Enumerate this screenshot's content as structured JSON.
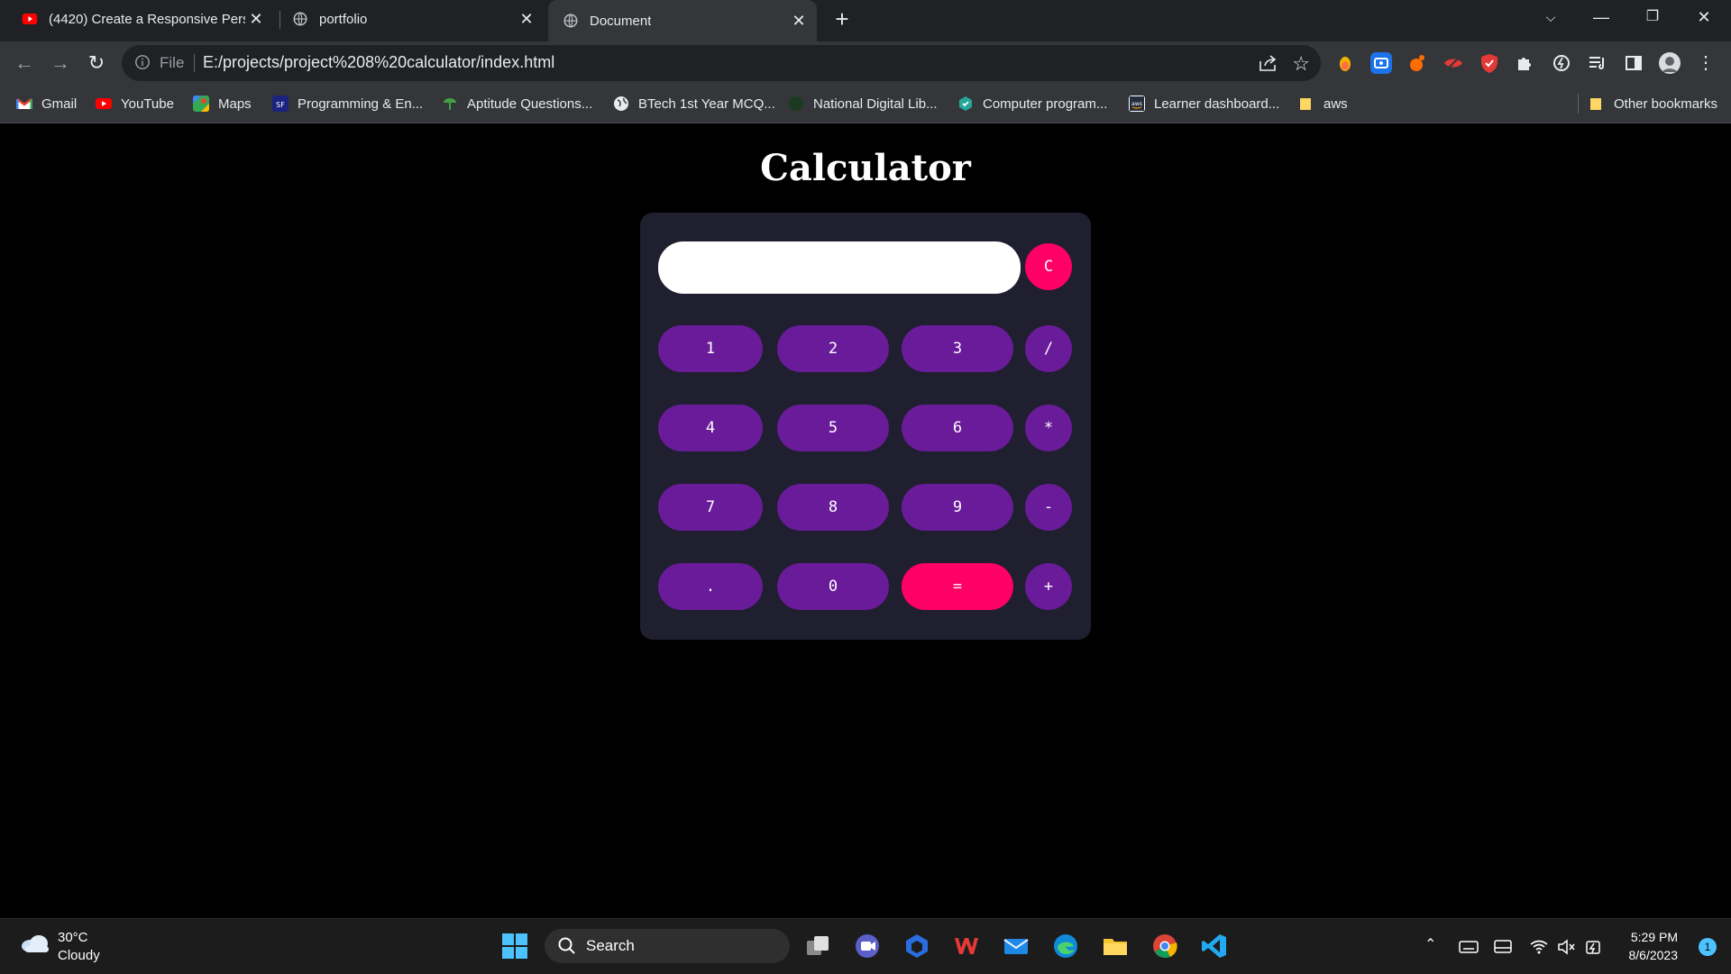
{
  "browser": {
    "tabs": [
      {
        "title": "(4420) Create a Responsive Perso",
        "favicon": "youtube-icon",
        "active": false
      },
      {
        "title": "portfolio",
        "favicon": "globe-icon",
        "active": false
      },
      {
        "title": "Document",
        "favicon": "globe-icon",
        "active": true
      }
    ],
    "new_tab_label": "+",
    "address": {
      "scheme_label": "File",
      "url": "E:/projects/project%208%20calculator/index.html"
    },
    "bookmarks": [
      {
        "label": "Gmail",
        "icon": "gmail-icon"
      },
      {
        "label": "YouTube",
        "icon": "youtube-icon"
      },
      {
        "label": "Maps",
        "icon": "maps-icon"
      },
      {
        "label": "Programming & En...",
        "icon": "programming-icon"
      },
      {
        "label": "Aptitude Questions...",
        "icon": "aptitude-icon"
      },
      {
        "label": "BTech 1st Year MCQ...",
        "icon": "globe-icon"
      },
      {
        "label": "National Digital Lib...",
        "icon": "ndl-icon"
      },
      {
        "label": "Computer program...",
        "icon": "coding-icon"
      },
      {
        "label": "Learner dashboard...",
        "icon": "aws-icon"
      },
      {
        "label": "aws",
        "icon": "folder-icon"
      }
    ],
    "other_bookmarks": "Other bookmarks"
  },
  "page": {
    "title": "Calculator",
    "display_value": "",
    "clear_label": "C",
    "rows": [
      [
        "1",
        "2",
        "3",
        "/"
      ],
      [
        "4",
        "5",
        "6",
        "*"
      ],
      [
        "7",
        "8",
        "9",
        "-"
      ],
      [
        ".",
        "0",
        "=",
        "+"
      ]
    ],
    "colors": {
      "background": "#000000",
      "panel": "#1f1f2f",
      "key": "#6a1b9a",
      "accent": "#ff0066",
      "display": "#ffffff"
    }
  },
  "taskbar": {
    "weather": {
      "temp": "30°C",
      "desc": "Cloudy"
    },
    "search_label": "Search",
    "time": "5:29 PM",
    "date": "8/6/2023",
    "notifications": "1"
  }
}
